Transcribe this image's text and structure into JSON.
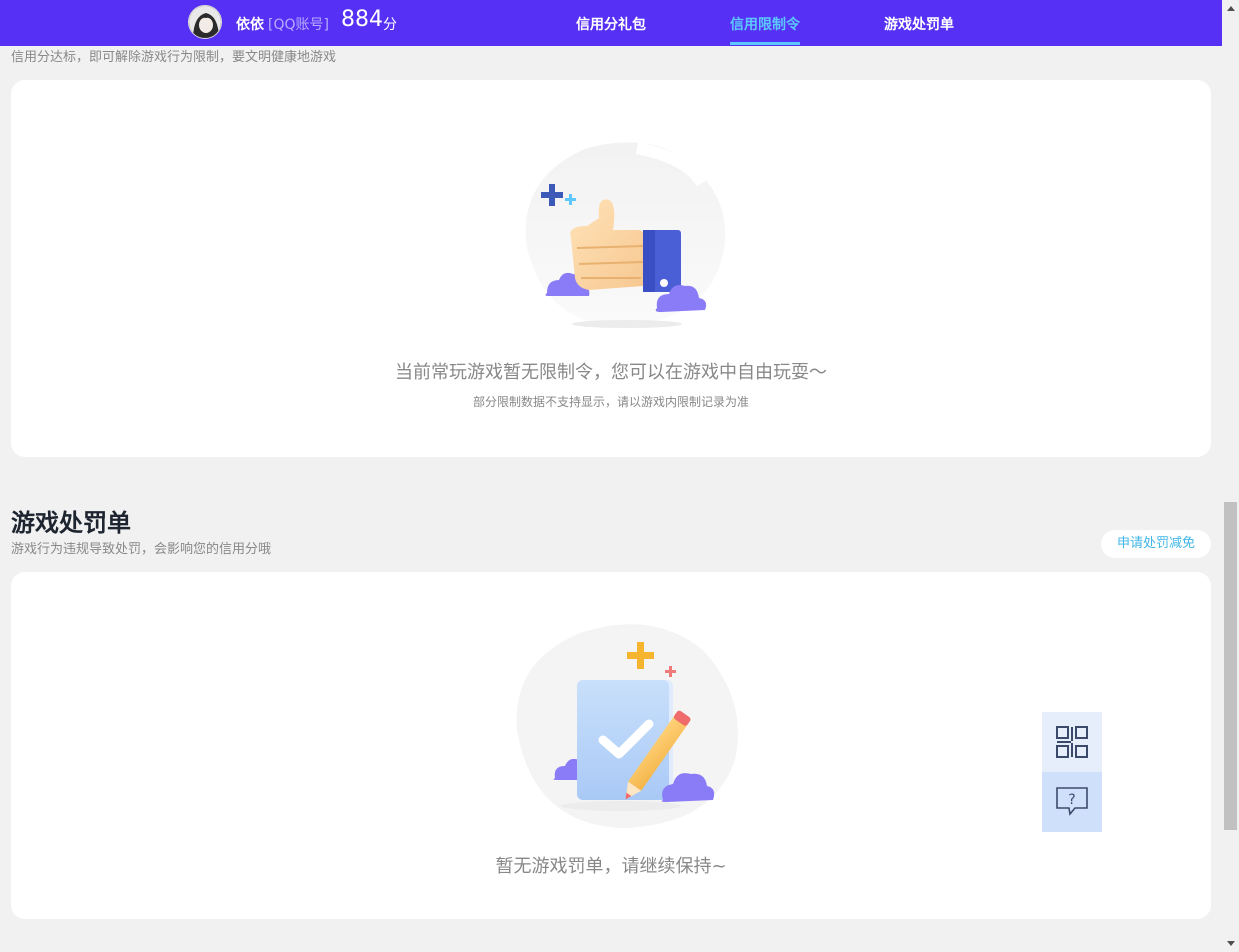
{
  "header": {
    "username": "依依",
    "account_type": "[QQ账号]",
    "score": "884",
    "score_unit": "分",
    "tabs": [
      {
        "label": "信用分礼包"
      },
      {
        "label": "信用限制令"
      },
      {
        "label": "游戏处罚单"
      }
    ],
    "active_tab": "信用限制令"
  },
  "restriction_section": {
    "description": "信用分达标，即可解除游戏行为限制，要文明健康地游戏",
    "empty_title": "当前常玩游戏暂无限制令，您可以在游戏中自由玩耍～",
    "empty_note": "部分限制数据不支持显示，请以游戏内限制记录为准"
  },
  "penalty_section": {
    "title": "游戏处罚单",
    "description": "游戏行为违规导致处罚，会影响您的信用分哦",
    "appeal_button": "申请处罚减免",
    "empty_title": "暂无游戏罚单，请继续保持~"
  },
  "float_panel": {
    "qr_icon": "qr-code-icon",
    "help_icon": "help-chat-icon",
    "help_symbol": "?"
  },
  "colors": {
    "topbar": "#5631f5",
    "active_tab": "#5cc8ff",
    "appeal_text": "#3fb6e6",
    "thumb_cuff": "#4a5fd6",
    "cloud": "#8a7cf6"
  }
}
